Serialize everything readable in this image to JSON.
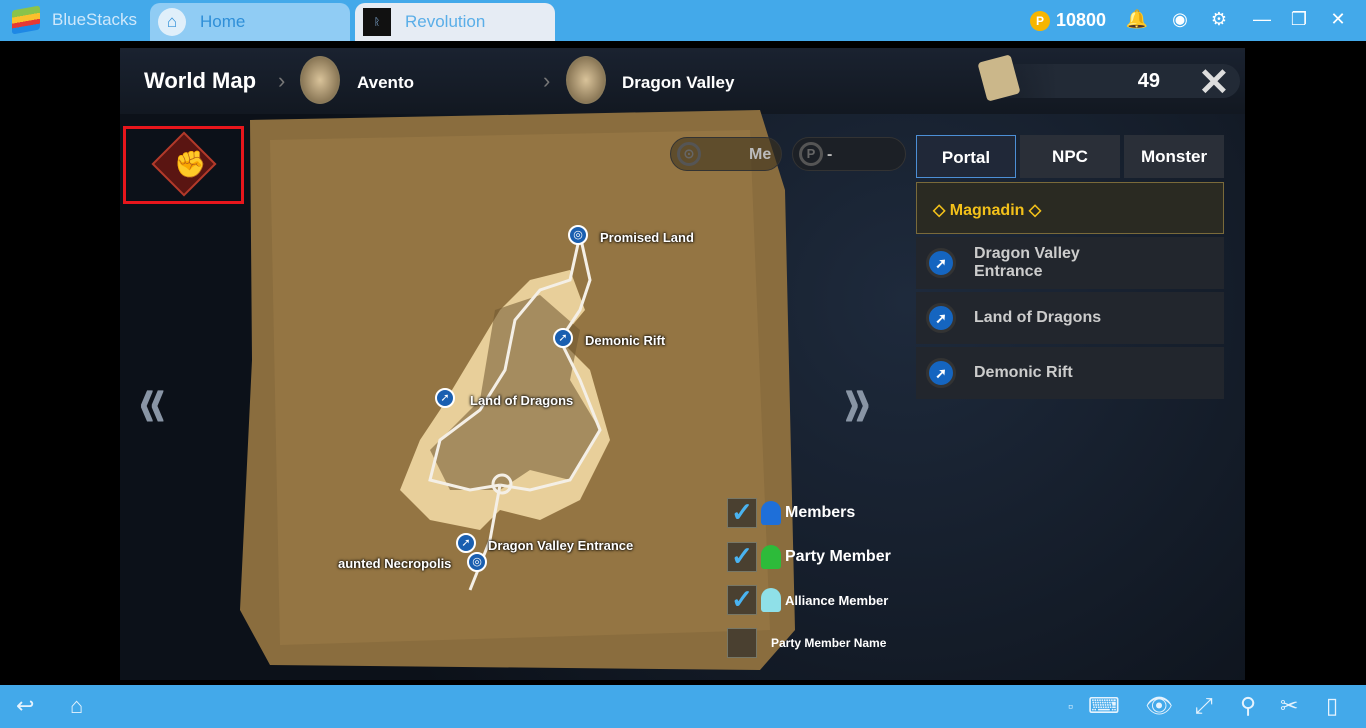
{
  "titlebar": {
    "app": "BlueStacks",
    "tabs": [
      {
        "label": "Home"
      },
      {
        "label": "Revolution"
      }
    ],
    "coins": "10800",
    "icons": [
      "bell-icon",
      "account-icon",
      "gear-icon",
      "minimize-icon",
      "restore-icon",
      "close-icon"
    ]
  },
  "header": {
    "title": "World Map",
    "breadcrumb": [
      "Avento",
      "Dragon Valley"
    ],
    "scroll_count": "49"
  },
  "toggles": {
    "members": "Me",
    "party": "-"
  },
  "tabs": [
    "Portal",
    "NPC",
    "Monster"
  ],
  "list": {
    "group": "◇ Magnadin ◇",
    "items": [
      "Dragon Valley Entrance",
      "Land of Dragons",
      "Demonic Rift"
    ]
  },
  "map_labels": [
    "Promised Land",
    "Demonic Rift",
    "Land of Dragons",
    "Dragon Valley Entrance",
    "aunted Necropolis"
  ],
  "legend": [
    {
      "label": "Members",
      "checked": true,
      "color": "#1e6fd9"
    },
    {
      "label": "Party Member",
      "checked": true,
      "color": "#2dbb3a"
    },
    {
      "label": "Alliance Member",
      "checked": true,
      "color": "#8fe0e8"
    },
    {
      "label": "Party Member Name",
      "checked": false
    }
  ],
  "bottombar": {
    "icons": [
      "back-icon",
      "home-icon",
      "keyboard-icon",
      "eye-icon",
      "fullscreen-icon",
      "location-icon",
      "scissors-icon",
      "rotate-icon"
    ]
  }
}
